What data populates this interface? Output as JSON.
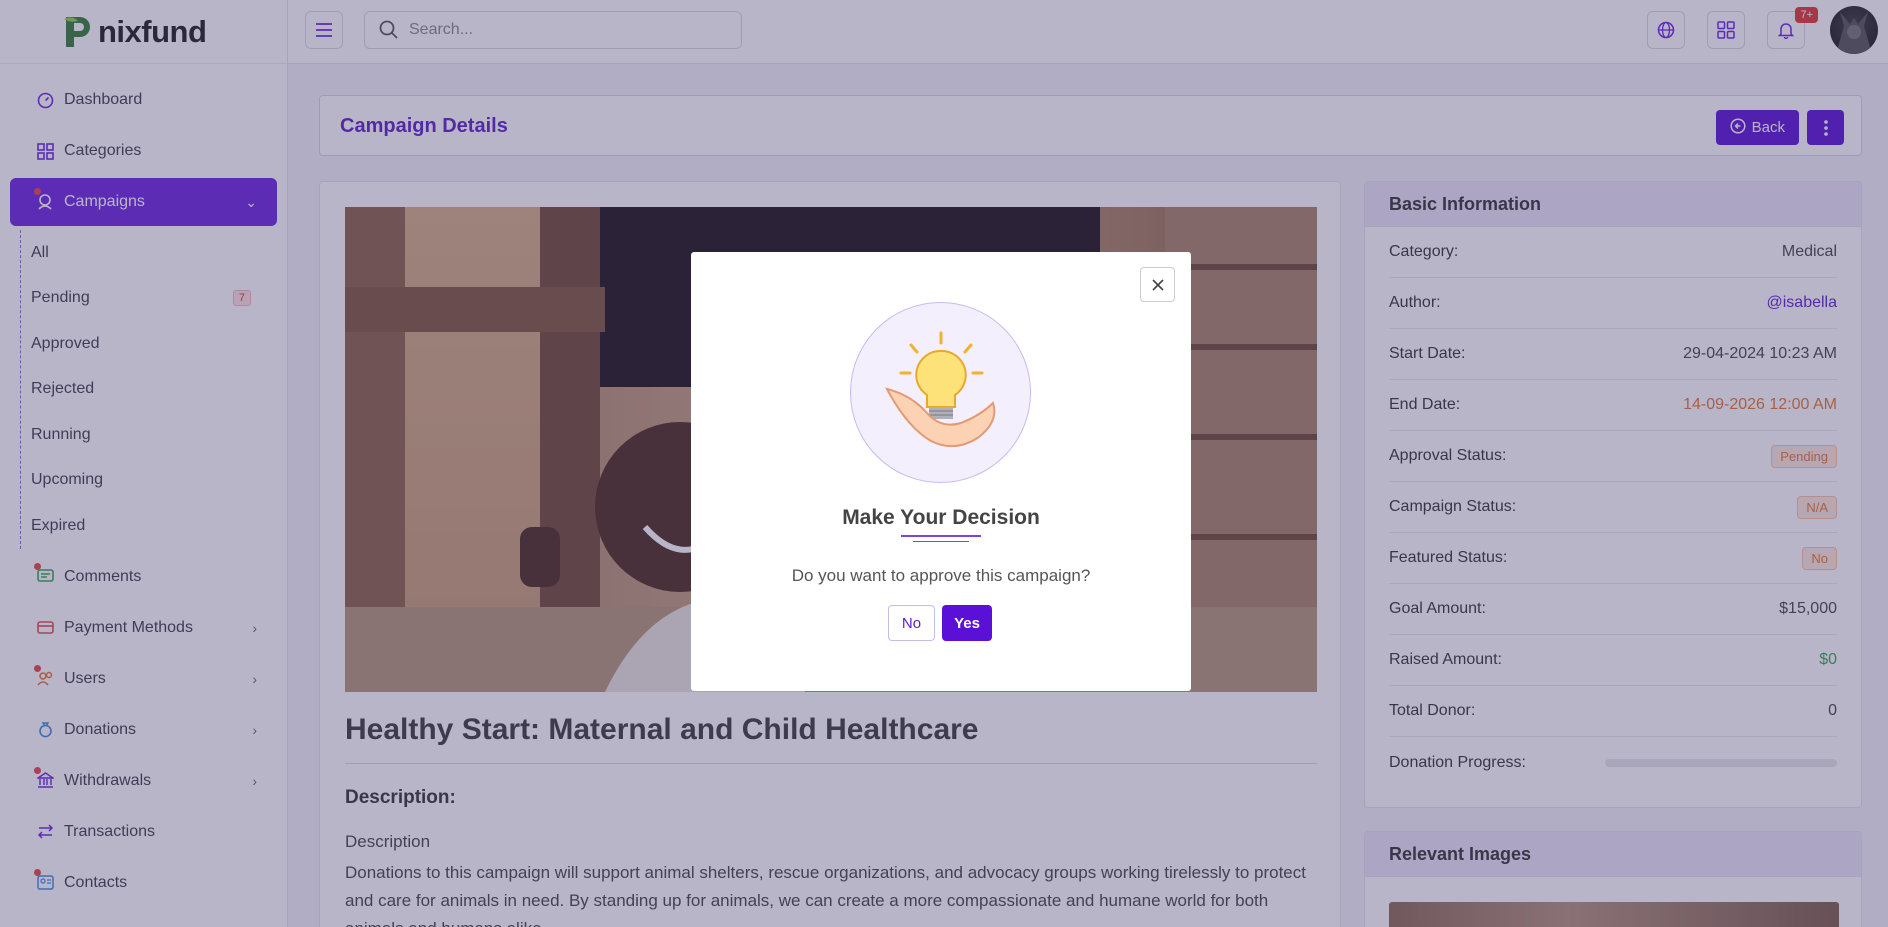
{
  "brand": {
    "name": "nixfund",
    "accent": "#6a22e0"
  },
  "topbar": {
    "search_placeholder": "Search...",
    "notification_count": "7+",
    "icons": [
      "menu-icon",
      "search-icon",
      "globe-icon",
      "apps-grid-icon",
      "bell-icon"
    ]
  },
  "sidebar": {
    "items": [
      {
        "label": "Dashboard",
        "icon": "dashboard-icon"
      },
      {
        "label": "Categories",
        "icon": "grid-icon"
      },
      {
        "label": "Campaigns",
        "icon": "campaign-icon",
        "active": true
      },
      {
        "label": "Comments",
        "icon": "comment-icon"
      },
      {
        "label": "Payment Methods",
        "icon": "card-icon"
      },
      {
        "label": "Users",
        "icon": "users-icon"
      },
      {
        "label": "Donations",
        "icon": "donation-icon"
      },
      {
        "label": "Withdrawals",
        "icon": "bank-icon"
      },
      {
        "label": "Transactions",
        "icon": "transfer-icon"
      },
      {
        "label": "Contacts",
        "icon": "contact-icon"
      }
    ],
    "campaigns_sub": [
      {
        "label": "All"
      },
      {
        "label": "Pending",
        "badge": "7"
      },
      {
        "label": "Approved"
      },
      {
        "label": "Rejected"
      },
      {
        "label": "Running"
      },
      {
        "label": "Upcoming"
      },
      {
        "label": "Expired"
      }
    ]
  },
  "page": {
    "title": "Campaign Details",
    "back_label": "Back"
  },
  "campaign": {
    "title": "Healthy Start: Maternal and Child Healthcare",
    "description_heading": "Description:",
    "description_label": "Description",
    "description_text": "Donations to this campaign will support animal shelters, rescue organizations, and advocacy groups working tirelessly to protect and care for animals in need. By standing up for animals, we can create a more compassionate and humane world for both animals and humans alike."
  },
  "basic_info": {
    "heading": "Basic Information",
    "rows": [
      {
        "label": "Category:",
        "value": "Medical"
      },
      {
        "label": "Author:",
        "value": "@isabella",
        "color": "#5a1fc8"
      },
      {
        "label": "Start Date:",
        "value": "29-04-2024 10:23 AM"
      },
      {
        "label": "End Date:",
        "value": "14-09-2026 12:00 AM",
        "color": "#e3772e"
      },
      {
        "label": "Approval Status:",
        "value": "Pending",
        "pill": true
      },
      {
        "label": "Campaign Status:",
        "value": "N/A",
        "pill": true
      },
      {
        "label": "Featured Status:",
        "value": "No",
        "pill": true
      },
      {
        "label": "Goal Amount:",
        "value": "$15,000"
      },
      {
        "label": "Raised Amount:",
        "value": "$0",
        "color": "#2fa84f"
      },
      {
        "label": "Total Donor:",
        "value": "0"
      },
      {
        "label": "Donation Progress:",
        "progress": 0
      }
    ]
  },
  "relevant_images": {
    "heading": "Relevant Images"
  },
  "modal": {
    "title": "Make Your Decision",
    "question": "Do you want to approve this campaign?",
    "no_label": "No",
    "yes_label": "Yes",
    "illustration": "lightbulb-hand-icon"
  }
}
